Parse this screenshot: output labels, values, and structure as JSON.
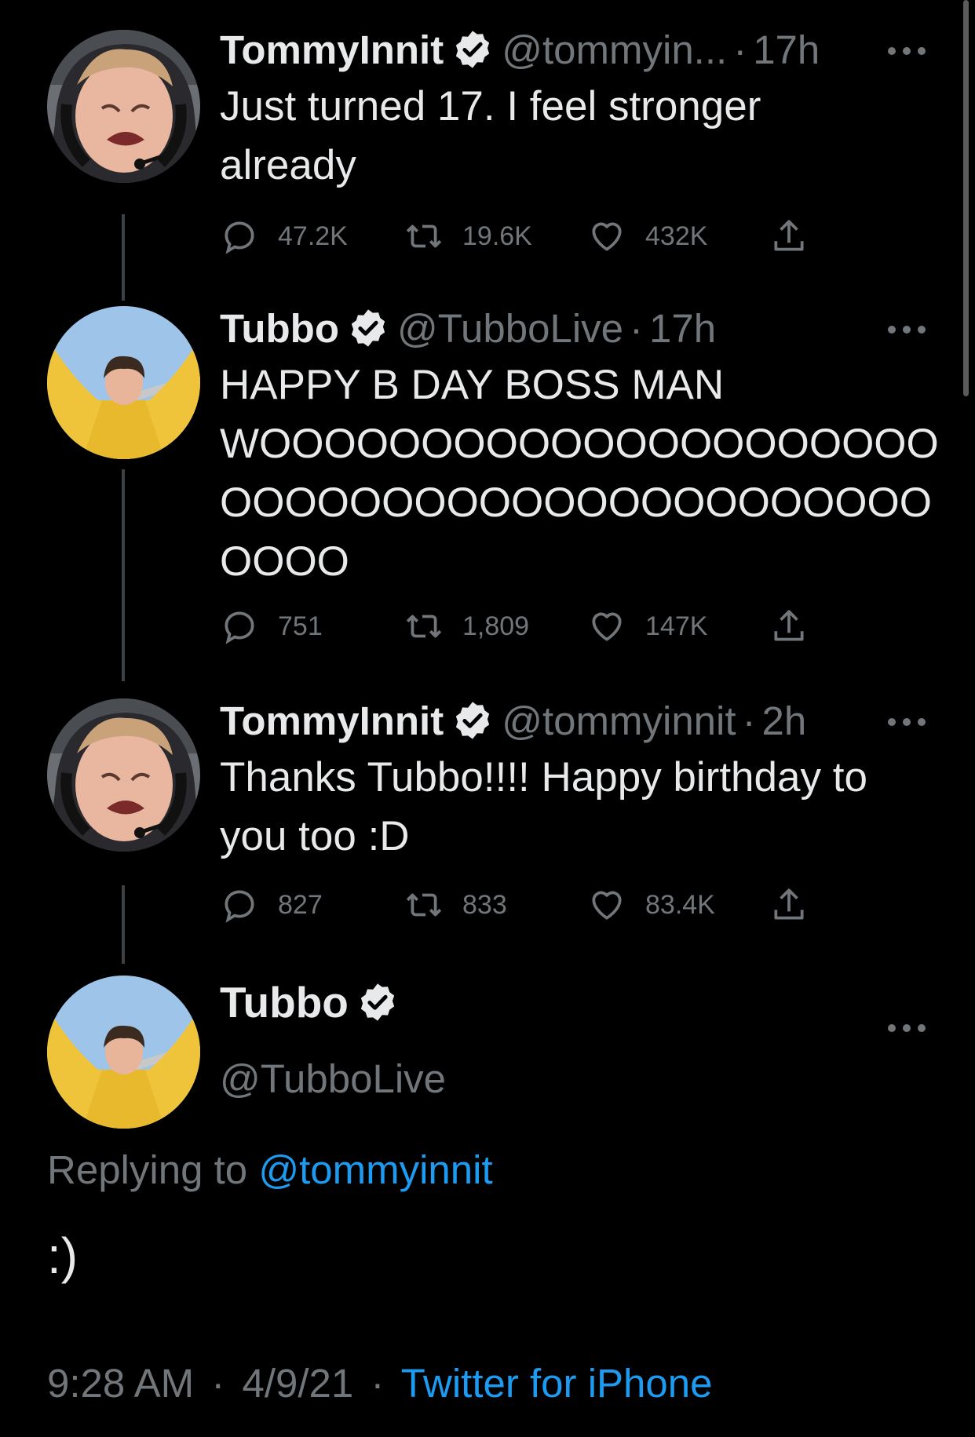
{
  "thread": [
    {
      "author": "TommyInnit",
      "handle": "@tommyin...",
      "time": "17h",
      "text": "Just turned 17. I feel stronger\nalready",
      "replies": "47.2K",
      "retweets": "19.6K",
      "likes": "432K"
    },
    {
      "author": "Tubbo",
      "handle": "@TubboLive",
      "time": "17h",
      "text": "HAPPY B DAY BOSS MAN\nWOOOOOOOOOOOOOOOOOOOOO\nOOOOOOOOOOOOOOOOOOOOOO\nOOOO",
      "replies": "751",
      "retweets": "1,809",
      "likes": "147K"
    },
    {
      "author": "TommyInnit",
      "handle": "@tommyinnit",
      "time": "2h",
      "text": "Thanks Tubbo!!!! Happy birthday to\nyou too :D",
      "replies": "827",
      "retweets": "833",
      "likes": "83.4K"
    }
  ],
  "main_tweet": {
    "author": "Tubbo",
    "handle": "@TubboLive",
    "replying_prefix": "Replying to",
    "replying_to": "@tommyinnit",
    "text": ":)",
    "timestamp": "9:28 AM",
    "date": "4/9/21",
    "separator": "·",
    "source": "Twitter for iPhone"
  },
  "colors": {
    "background": "#000000",
    "text": "#e7e9ea",
    "secondary": "#71767b",
    "link": "#1d9bf0",
    "thread_line": "#3e4144"
  },
  "icons": [
    "verified-badge-icon",
    "more-icon",
    "reply-icon",
    "retweet-icon",
    "like-icon",
    "share-icon"
  ]
}
